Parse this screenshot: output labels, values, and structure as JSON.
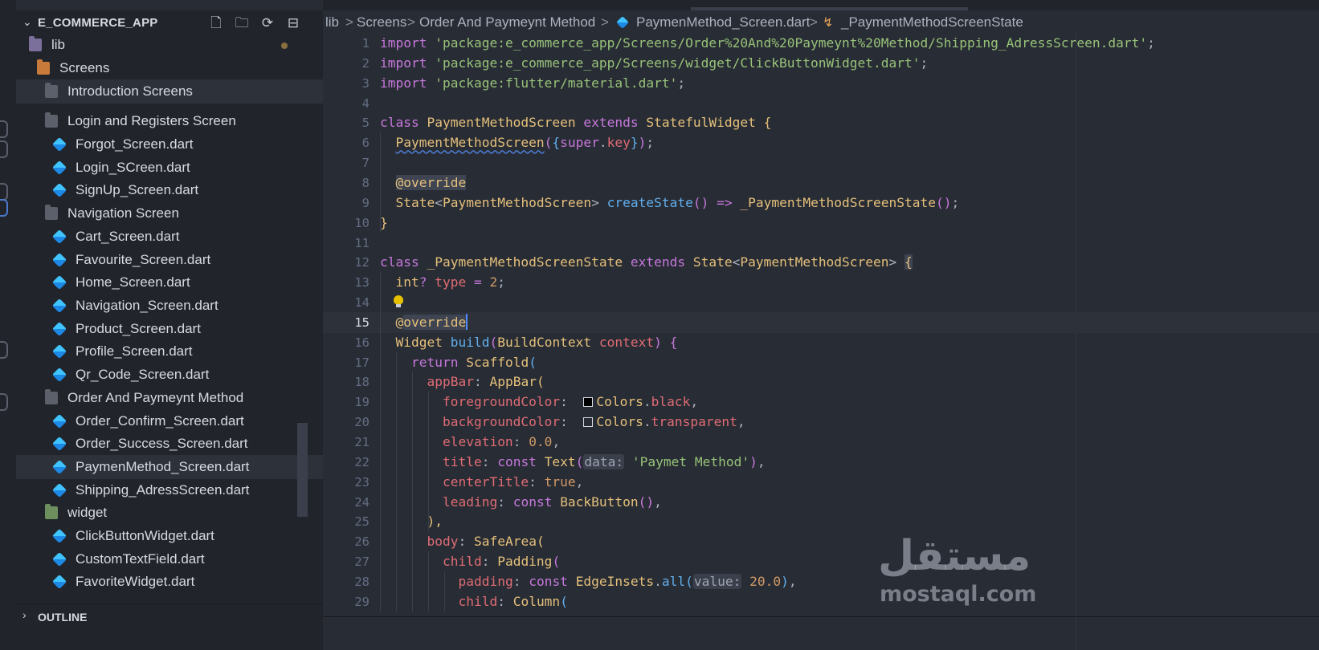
{
  "sidebar": {
    "title": "E_COMMERCE_APP",
    "header_icons": [
      "new-file-icon",
      "new-folder-icon",
      "refresh-icon",
      "collapse-all-icon"
    ],
    "tree": [
      {
        "label": "lib",
        "kind": "folder-lib"
      },
      {
        "label": "Screens",
        "kind": "folder-orange"
      },
      {
        "label": "Introduction Screens",
        "kind": "folder"
      },
      {
        "label": "Login and Registers Screen",
        "kind": "folder"
      },
      {
        "label": "Forgot_Screen.dart",
        "kind": "dart"
      },
      {
        "label": "Login_SCreen.dart",
        "kind": "dart"
      },
      {
        "label": "SignUp_Screen.dart",
        "kind": "dart"
      },
      {
        "label": "Navigation  Screen",
        "kind": "folder"
      },
      {
        "label": "Cart_Screen.dart",
        "kind": "dart"
      },
      {
        "label": "Favourite_Screen.dart",
        "kind": "dart"
      },
      {
        "label": "Home_Screen.dart",
        "kind": "dart"
      },
      {
        "label": "Navigation_Screen.dart",
        "kind": "dart"
      },
      {
        "label": "Product_Screen.dart",
        "kind": "dart"
      },
      {
        "label": "Profile_Screen.dart",
        "kind": "dart"
      },
      {
        "label": "Qr_Code_Screen.dart",
        "kind": "dart"
      },
      {
        "label": "Order And Paymeynt Method",
        "kind": "folder"
      },
      {
        "label": "Order_Confirm_Screen.dart",
        "kind": "dart"
      },
      {
        "label": "Order_Success_Screen.dart",
        "kind": "dart"
      },
      {
        "label": "PaymenMethod_Screen.dart",
        "kind": "dart"
      },
      {
        "label": "Shipping_AdressScreen.dart",
        "kind": "dart"
      },
      {
        "label": "widget",
        "kind": "folder-widget"
      },
      {
        "label": "ClickButtonWidget.dart",
        "kind": "dart"
      },
      {
        "label": "CustomTextField.dart",
        "kind": "dart"
      },
      {
        "label": "FavoriteWidget.dart",
        "kind": "dart"
      }
    ],
    "outline_title": "OUTLINE"
  },
  "breadcrumb": {
    "items": [
      "lib",
      "Screens",
      "Order And Paymeynt Method",
      "PaymenMethod_Screen.dart",
      "_PaymentMethodScreenState"
    ],
    "separator": ">"
  },
  "editor": {
    "current_line": 15,
    "lines": [
      {
        "n": "1",
        "code": [
          [
            "k",
            "import"
          ],
          [
            "p",
            " "
          ],
          [
            "s",
            "'package:e_commerce_app/Screens/Order%20And%20Paymeynt%20Method/Shipping_AdressScreen.dart'"
          ],
          [
            "p",
            ";"
          ]
        ]
      },
      {
        "n": "2",
        "code": [
          [
            "k",
            "import"
          ],
          [
            "p",
            " "
          ],
          [
            "s",
            "'package:e_commerce_app/Screens/widget/ClickButtonWidget.dart'"
          ],
          [
            "p",
            ";"
          ]
        ]
      },
      {
        "n": "3",
        "code": [
          [
            "k",
            "import"
          ],
          [
            "p",
            " "
          ],
          [
            "s",
            "'package:flutter/material.dart'"
          ],
          [
            "p",
            ";"
          ]
        ]
      },
      {
        "n": "4",
        "code": []
      },
      {
        "n": "5",
        "code": [
          [
            "k",
            "class"
          ],
          [
            "p",
            " "
          ],
          [
            "t",
            "PaymentMethodScreen"
          ],
          [
            "p",
            " "
          ],
          [
            "k",
            "extends"
          ],
          [
            "p",
            " "
          ],
          [
            "t",
            "StatefulWidget"
          ],
          [
            "p",
            " "
          ],
          [
            "br1",
            "{"
          ]
        ]
      },
      {
        "n": "6",
        "code": [
          [
            "p",
            "  "
          ],
          [
            "t squig",
            "PaymentMethodScreen"
          ],
          [
            "br2",
            "("
          ],
          [
            "br3",
            "{"
          ],
          [
            "k",
            "super"
          ],
          [
            "p",
            "."
          ],
          [
            "v",
            "key"
          ],
          [
            "br3",
            "}"
          ],
          [
            "br2",
            ")"
          ],
          [
            "p",
            ";"
          ]
        ]
      },
      {
        "n": "7",
        "code": []
      },
      {
        "n": "8",
        "code": [
          [
            "p",
            "  "
          ],
          [
            "t hl",
            "@override"
          ]
        ]
      },
      {
        "n": "9",
        "code": [
          [
            "p",
            "  "
          ],
          [
            "t",
            "State"
          ],
          [
            "p",
            "<"
          ],
          [
            "t",
            "PaymentMethodScreen"
          ],
          [
            "p",
            "> "
          ],
          [
            "f",
            "createState"
          ],
          [
            "br2",
            "()"
          ],
          [
            "p",
            " "
          ],
          [
            "k",
            "=>"
          ],
          [
            "p",
            " "
          ],
          [
            "t",
            "_PaymentMethodScreenState"
          ],
          [
            "br2",
            "()"
          ],
          [
            "p",
            ";"
          ]
        ]
      },
      {
        "n": "10",
        "code": [
          [
            "br1",
            "}"
          ]
        ]
      },
      {
        "n": "11",
        "code": []
      },
      {
        "n": "12",
        "code": [
          [
            "k",
            "class"
          ],
          [
            "p",
            " "
          ],
          [
            "t",
            "_PaymentMethodScreenState"
          ],
          [
            "p",
            " "
          ],
          [
            "k",
            "extends"
          ],
          [
            "p",
            " "
          ],
          [
            "t",
            "State"
          ],
          [
            "p",
            "<"
          ],
          [
            "t",
            "PaymentMethodScreen"
          ],
          [
            "p",
            "> "
          ],
          [
            "br1 hl",
            "{"
          ]
        ]
      },
      {
        "n": "13",
        "code": [
          [
            "p",
            "  "
          ],
          [
            "t",
            "int"
          ],
          [
            "k",
            "?"
          ],
          [
            "p",
            " "
          ],
          [
            "v",
            "type"
          ],
          [
            "p",
            " "
          ],
          [
            "k",
            "="
          ],
          [
            "p",
            " "
          ],
          [
            "n",
            "2"
          ],
          [
            "p",
            ";"
          ]
        ]
      },
      {
        "n": "14",
        "code": []
      },
      {
        "n": "15",
        "code": [
          [
            "p",
            "  "
          ],
          [
            "t",
            "@"
          ],
          [
            "t hl",
            "override"
          ]
        ]
      },
      {
        "n": "16",
        "code": [
          [
            "p",
            "  "
          ],
          [
            "t",
            "Widget"
          ],
          [
            "p",
            " "
          ],
          [
            "f",
            "build"
          ],
          [
            "br2",
            "("
          ],
          [
            "t",
            "BuildContext"
          ],
          [
            "p",
            " "
          ],
          [
            "v",
            "context"
          ],
          [
            "br2",
            ")"
          ],
          [
            "p",
            " "
          ],
          [
            "br2",
            "{"
          ]
        ]
      },
      {
        "n": "17",
        "code": [
          [
            "p",
            "    "
          ],
          [
            "k",
            "return"
          ],
          [
            "p",
            " "
          ],
          [
            "t",
            "Scaffold"
          ],
          [
            "br3",
            "("
          ]
        ]
      },
      {
        "n": "18",
        "code": [
          [
            "p",
            "      "
          ],
          [
            "v",
            "appBar"
          ],
          [
            "p",
            ": "
          ],
          [
            "t",
            "AppBar"
          ],
          [
            "br1",
            "("
          ]
        ]
      },
      {
        "n": "19",
        "code": [
          [
            "p",
            "        "
          ],
          [
            "v",
            "foregroundColor"
          ],
          [
            "p",
            ":  "
          ],
          [
            "sw",
            "#000000"
          ],
          [
            "t",
            "Colors"
          ],
          [
            "p",
            "."
          ],
          [
            "v",
            "black"
          ],
          [
            "p",
            ","
          ]
        ]
      },
      {
        "n": "20",
        "code": [
          [
            "p",
            "        "
          ],
          [
            "v",
            "backgroundColor"
          ],
          [
            "p",
            ":  "
          ],
          [
            "sw",
            "transparent"
          ],
          [
            "t",
            "Colors"
          ],
          [
            "p",
            "."
          ],
          [
            "v",
            "transparent"
          ],
          [
            "p",
            ","
          ]
        ]
      },
      {
        "n": "21",
        "code": [
          [
            "p",
            "        "
          ],
          [
            "v",
            "elevation"
          ],
          [
            "p",
            ": "
          ],
          [
            "n",
            "0.0"
          ],
          [
            "p",
            ","
          ]
        ]
      },
      {
        "n": "22",
        "code": [
          [
            "p",
            "        "
          ],
          [
            "v",
            "title"
          ],
          [
            "p",
            ": "
          ],
          [
            "k",
            "const"
          ],
          [
            "p",
            " "
          ],
          [
            "t",
            "Text"
          ],
          [
            "br2",
            "("
          ],
          [
            "hint",
            "data:"
          ],
          [
            "p",
            " "
          ],
          [
            "s",
            "'Paymet Method'"
          ],
          [
            "br2",
            ")"
          ],
          [
            "p",
            ","
          ]
        ]
      },
      {
        "n": "23",
        "code": [
          [
            "p",
            "        "
          ],
          [
            "v",
            "centerTitle"
          ],
          [
            "p",
            ": "
          ],
          [
            "n",
            "true"
          ],
          [
            "p",
            ","
          ]
        ]
      },
      {
        "n": "24",
        "code": [
          [
            "p",
            "        "
          ],
          [
            "v",
            "leading"
          ],
          [
            "p",
            ": "
          ],
          [
            "k",
            "const"
          ],
          [
            "p",
            " "
          ],
          [
            "t",
            "BackButton"
          ],
          [
            "br2",
            "()"
          ],
          [
            "p",
            ","
          ]
        ]
      },
      {
        "n": "25",
        "code": [
          [
            "p",
            "      "
          ],
          [
            "br1",
            "),"
          ]
        ]
      },
      {
        "n": "26",
        "code": [
          [
            "p",
            "      "
          ],
          [
            "v",
            "body"
          ],
          [
            "p",
            ": "
          ],
          [
            "t",
            "SafeArea"
          ],
          [
            "br1",
            "("
          ]
        ]
      },
      {
        "n": "27",
        "code": [
          [
            "p",
            "        "
          ],
          [
            "v",
            "child"
          ],
          [
            "p",
            ": "
          ],
          [
            "t",
            "Padding"
          ],
          [
            "br2",
            "("
          ]
        ]
      },
      {
        "n": "28",
        "code": [
          [
            "p",
            "          "
          ],
          [
            "v",
            "padding"
          ],
          [
            "p",
            ": "
          ],
          [
            "k",
            "const"
          ],
          [
            "p",
            " "
          ],
          [
            "t",
            "EdgeInsets"
          ],
          [
            "p",
            "."
          ],
          [
            "f",
            "all"
          ],
          [
            "br3",
            "("
          ],
          [
            "hint",
            "value:"
          ],
          [
            "p",
            " "
          ],
          [
            "n",
            "20.0"
          ],
          [
            "br3",
            ")"
          ],
          [
            "p",
            ","
          ]
        ]
      },
      {
        "n": "29",
        "code": [
          [
            "p",
            "          "
          ],
          [
            "v",
            "child"
          ],
          [
            "p",
            ": "
          ],
          [
            "t",
            "Column"
          ],
          [
            "br3",
            "("
          ]
        ]
      }
    ]
  },
  "watermark": {
    "arabic": "مستقل",
    "latin": "mostaql.com"
  },
  "colors": {
    "editor_bg": "#282c34",
    "sidebar_bg": "#21252b",
    "accent": "#4d78cc"
  }
}
